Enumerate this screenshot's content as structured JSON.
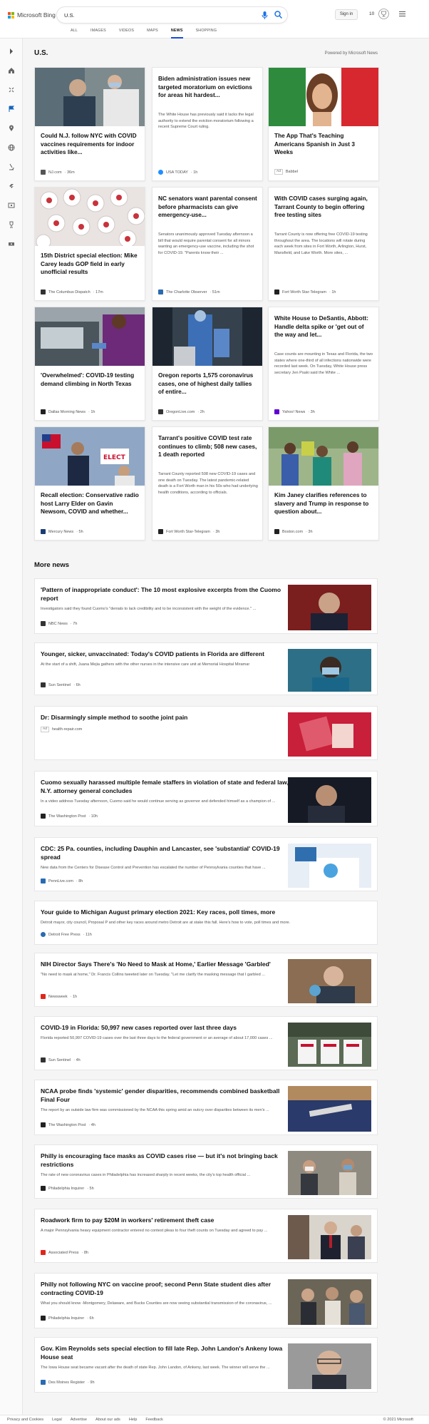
{
  "brand": {
    "name": "Microsoft Bing",
    "colors": [
      "#f25022",
      "#7fba00",
      "#00a4ef",
      "#ffb900"
    ]
  },
  "search": {
    "value": "U.S.",
    "placeholder": ""
  },
  "header": {
    "signin_label": "Sign in",
    "points": "10"
  },
  "tabs": [
    "ALL",
    "IMAGES",
    "VIDEOS",
    "MAPS",
    "NEWS",
    "SHOPPING"
  ],
  "active_tab": "NEWS",
  "section": {
    "title": "U.S.",
    "powered_by": "Powered by Microsoft News"
  },
  "cards": [
    {
      "title": "Could N.J. follow NYC with COVID vaccines requirements for indoor activities like...",
      "body": "",
      "source": "NJ.com",
      "time": "· 36m",
      "fav_color": "#555"
    },
    {
      "title": "Biden administration issues new targeted moratorium on evictions for areas hit hardest...",
      "body": "The White House has previously said it lacks the legal authority to extend the eviction moratorium following a recent Supreme Court ruling.",
      "source": "USA TODAY",
      "time": "· 1h",
      "fav_color": "#1e90ff"
    },
    {
      "title": "The App That's Teaching Americans Spanish in Just 3 Weeks",
      "body": "",
      "source": "Babbel",
      "time": "",
      "ad": "Ad",
      "fav_color": ""
    },
    {
      "title": "15th District special election: Mike Carey leads GOP field in early unofficial results",
      "body": "",
      "source": "The Columbus Dispatch",
      "time": "· 17m",
      "fav_color": "#333"
    },
    {
      "title": "NC senators want parental consent before pharmacists can give emergency-use...",
      "body": "Senators unanimously approved Tuesday afternoon a bill that would require parental consent for all minors wanting an emergency-use vaccine, including the shot for COVID-19. \"Parents know their ...",
      "source": "The Charlotte Observer",
      "time": "· 51m",
      "fav_color": "#2a6bb1"
    },
    {
      "title": "With COVID cases surging again, Tarrant County to begin offering free testing sites",
      "body": "Tarrant County is now offering free COVID-19 testing throughout the area. The locations will rotate during each week from sites in Fort Worth, Arlington, Hurst, Mansfield, and Lake Worth. More sites, ...",
      "source": "Fort Worth Star-Telegram",
      "time": "· 1h",
      "fav_color": "#222"
    },
    {
      "title": "'Overwhelmed': COVID-19 testing demand climbing in North Texas",
      "body": "",
      "source": "Dallas Morning News",
      "time": "· 1h",
      "fav_color": "#222"
    },
    {
      "title": "Oregon reports 1,575 coronavirus cases, one of highest daily tallies of entire...",
      "body": "",
      "source": "OregonLive.com",
      "time": "· 2h",
      "fav_color": "#333"
    },
    {
      "title": "White House to DeSantis, Abbott: Handle delta spike or 'get out of the way and let...",
      "body": "Case counts are mounting in Texas and Florida, the two states where one-third of all infections nationwide were recorded last week. On Tuesday, White House press secretary Jen Psaki said the White ...",
      "source": "Yahoo! News",
      "time": "· 3h",
      "fav_color": "#6001d2"
    },
    {
      "title": "Recall election: Conservative radio host Larry Elder on Gavin Newsom, COVID and whether...",
      "body": "",
      "source": "Mercury News",
      "time": "· 5h",
      "fav_color": "#1a3c73"
    },
    {
      "title": "Tarrant's positive COVID test rate continues to climb; 508 new cases, 1 death reported",
      "body": "Tarrant County reported 508 new COVID-19 cases and one death on Tuesday. The latest pandemic-related death is a Fort Worth man in his 50s who had underlying health conditions, according to officials.",
      "source": "Fort Worth Star-Telegram",
      "time": "· 3h",
      "fav_color": "#222"
    },
    {
      "title": "Kim Janey clarifies references to slavery and Trump in response to question about...",
      "body": "",
      "source": "Boston.com",
      "time": "· 3h",
      "fav_color": "#222"
    }
  ],
  "more_news": {
    "title": "More news"
  },
  "rows": [
    {
      "title": "'Pattern of inappropriate conduct': The 10 most explosive excerpts from the Cuomo report",
      "body": "Investigators said they found Cuomo's \"denials to lack credibility and to be inconsistent with the weight of the evidence.\" ...",
      "source": "NBC News",
      "time": "· 7h",
      "fav_color": "#333"
    },
    {
      "title": "Younger, sicker, unvaccinated: Today's COVID patients in Florida are different",
      "body": "At the start of a shift, Juana Mejia gathers with the other nurses in the intensive care unit at Memorial Hospital Miramar",
      "source": "Sun Sentinel",
      "time": "· 6h",
      "fav_color": "#333"
    },
    {
      "title": "Dr: Disarmingly simple method to soothe joint pain",
      "body": "",
      "source": "health-repair.com",
      "time": "",
      "ad": "Ad",
      "fav_color": ""
    },
    {
      "title": "Cuomo sexually harassed multiple female staffers in violation of state and federal law, N.Y. attorney general concludes",
      "body": "In a video address Tuesday afternoon, Cuomo said he would continue serving as governor and defended himself as a champion of ...",
      "source": "The Washington Post",
      "time": "· 10h",
      "fav_color": "#222"
    },
    {
      "title": "CDC: 25 Pa. counties, including Dauphin and Lancaster, see 'substantial' COVID-19 spread",
      "body": "New data from the Centers for Disease Control and Prevention has escalated the number of Pennsylvania counties that have ...",
      "source": "PennLive.com",
      "time": "· 8h",
      "fav_color": "#2a6bb1"
    },
    {
      "title": "Your guide to Michigan August primary election 2021: Key races, poll times, more",
      "body": "Detroit mayor, city council, Proposal P and other key races around metro Detroit are at stake this fall. Here's how to vote, poll times and more.",
      "source": "Detroit Free Press",
      "time": "· 11h",
      "fav_color": "#2a6bb1"
    },
    {
      "title": "NIH Director Says There's 'No Need to Mask at Home,' Earlier Message 'Garbled'",
      "body": "\"No need to mask at home,\" Dr. Francis Collins tweeted later on Tuesday. \"Let me clarify the masking message that I garbled ...",
      "source": "Newsweek",
      "time": "· 1h",
      "fav_color": "#e0261b"
    },
    {
      "title": "COVID-19 in Florida: 50,997 new cases reported over last three days",
      "body": "Florida reported 50,997 COVID-19 cases over the last three days to the federal government or an average of about 17,000 cases ...",
      "source": "Sun Sentinel",
      "time": "· 4h",
      "fav_color": "#333"
    },
    {
      "title": "NCAA probe finds 'systemic' gender disparities, recommends combined basketball Final Four",
      "body": "The report by an outside law firm was commissioned by the NCAA this spring amid an outcry over disparities between its men's ...",
      "source": "The Washington Post",
      "time": "· 4h",
      "fav_color": "#222"
    },
    {
      "title": "Philly is encouraging face masks as COVID cases rise — but it's not bringing back restrictions",
      "body": "The rate of new coronavirus cases in Philadelphia has increased sharply in recent weeks, the city's top health official ...",
      "source": "Philadelphia Inquirer",
      "time": "· 5h",
      "fav_color": "#222"
    },
    {
      "title": "Roadwork firm to pay $20M in workers' retirement theft case",
      "body": "A major Pennsylvania heavy equipment contractor entered no contest pleas to four theft counts on Tuesday and agreed to pay ...",
      "source": "Associated Press",
      "time": "· 8h",
      "fav_color": "#e0261b"
    },
    {
      "title": "Philly not following NYC on vaccine proof; second Penn State student dies after contracting COVID-19",
      "body": "What you should know -Montgomery, Delaware, and Bucks Counties are now seeing substantial transmission of the coronavirus, ...",
      "source": "Philadelphia Inquirer",
      "time": "· 6h",
      "fav_color": "#222"
    },
    {
      "title": "Gov. Kim Reynolds sets special election to fill late Rep. John Landon's Ankeny Iowa House seat",
      "body": "The Iowa House seat became vacant after the death of state Rep. John Landon, of Ankeny, last week. The winner will serve the ...",
      "source": "Des Moines Register",
      "time": "· 9h",
      "fav_color": "#2a6bb1"
    }
  ],
  "footer": {
    "links": [
      "Privacy and Cookies",
      "Legal",
      "Advertise",
      "About our ads",
      "Help",
      "Feedback"
    ],
    "copyright": "© 2021 Microsoft"
  }
}
